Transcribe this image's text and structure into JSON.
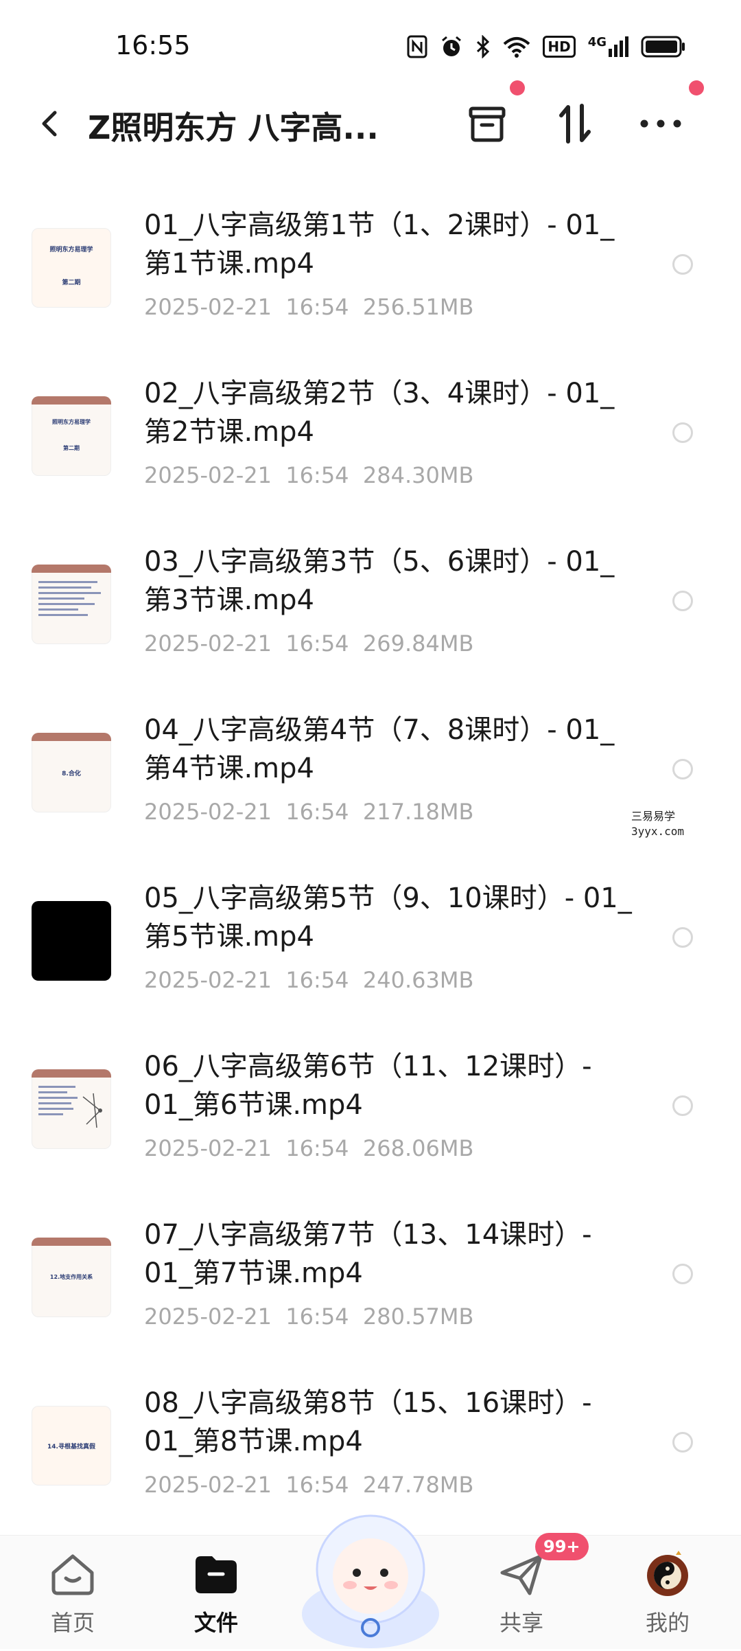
{
  "status_bar": {
    "time": "16:55",
    "network_badge": "HD",
    "signal_label": "4G"
  },
  "header": {
    "title": "Z照明东方 八字高...",
    "back_icon": "chevron-left-icon",
    "archive_icon": "archive-box-icon",
    "sort_icon": "sort-arrows-icon",
    "more_icon": "more-dots-icon",
    "notification_color": "#f0506e"
  },
  "files": [
    {
      "name": "01_八字高级第1节（1、2课时）- 01_第1节课.mp4",
      "date": "2025-02-21",
      "time": "16:54",
      "size": "256.51MB",
      "thumb_text": [
        "照明东方易理学",
        "第二期"
      ]
    },
    {
      "name": "02_八字高级第2节（3、4课时）- 01_第2节课.mp4",
      "date": "2025-02-21",
      "time": "16:54",
      "size": "284.30MB",
      "thumb_text": [
        "照明东方易理学",
        "第二期"
      ]
    },
    {
      "name": "03_八字高级第3节（5、6课时）- 01_第3节课.mp4",
      "date": "2025-02-21",
      "time": "16:54",
      "size": "269.84MB"
    },
    {
      "name": "04_八字高级第4节（7、8课时）- 01_第4节课.mp4",
      "date": "2025-02-21",
      "time": "16:54",
      "size": "217.18MB",
      "thumb_text": [
        "8.合化"
      ]
    },
    {
      "name": "05_八字高级第5节（9、10课时）- 01_第5节课.mp4",
      "date": "2025-02-21",
      "time": "16:54",
      "size": "240.63MB"
    },
    {
      "name": "06_八字高级第6节（11、12课时）- 01_第6节课.mp4",
      "date": "2025-02-21",
      "time": "16:54",
      "size": "268.06MB"
    },
    {
      "name": "07_八字高级第7节（13、14课时）- 01_第7节课.mp4",
      "date": "2025-02-21",
      "time": "16:54",
      "size": "280.57MB",
      "thumb_text": [
        "12.地支作用关系"
      ]
    },
    {
      "name": "08_八字高级第8节（15、16课时）- 01_第8节课.mp4",
      "date": "2025-02-21",
      "time": "16:54",
      "size": "247.78MB",
      "thumb_text": [
        "14.寻根基找真假"
      ]
    }
  ],
  "watermark": {
    "line1": "三易易学",
    "line2": "3yyx.com"
  },
  "bottom_nav": {
    "home": "首页",
    "files": "文件",
    "share": "共享",
    "mine": "我的",
    "share_badge": "99+",
    "home_icon": "home-icon",
    "files_icon": "folder-icon",
    "share_icon": "paper-plane-icon",
    "mine_icon": "avatar-icon",
    "mascot_icon": "mascot-icon"
  }
}
